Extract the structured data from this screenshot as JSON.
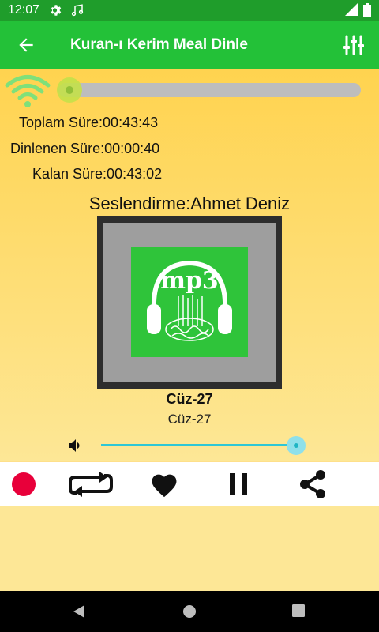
{
  "status_bar": {
    "time": "12:07",
    "icons": [
      "gear-icon",
      "music-note-icon",
      "signal-icon",
      "battery-icon"
    ]
  },
  "app_bar": {
    "title": "Kuran-ı Kerim Meal Dinle",
    "back_icon": "arrow-left-icon",
    "settings_icon": "equalizer-icon"
  },
  "player": {
    "progress": 0.015,
    "total_time": "Toplam Süre:00:43:43",
    "listened_time": "Dinlenen Süre:00:00:40",
    "remaining_time": "Kalan Süre:00:43:02",
    "narrator": "Seslendirme:Ahmet Deniz",
    "cover_text": "mp3",
    "track_title": "Cüz-27",
    "track_subtitle": "Cüz-27",
    "volume": 1.0
  },
  "controls": {
    "record_icon": "record-icon",
    "repeat_icon": "repeat-icon",
    "favorite_icon": "heart-icon",
    "pause_icon": "pause-icon",
    "share_icon": "share-icon"
  },
  "colors": {
    "status_bar": "#1f9d2b",
    "app_bar": "#23c138",
    "record": "#e8003a",
    "volume_accent": "#2ec7d6",
    "cover_green": "#2fc43a"
  }
}
